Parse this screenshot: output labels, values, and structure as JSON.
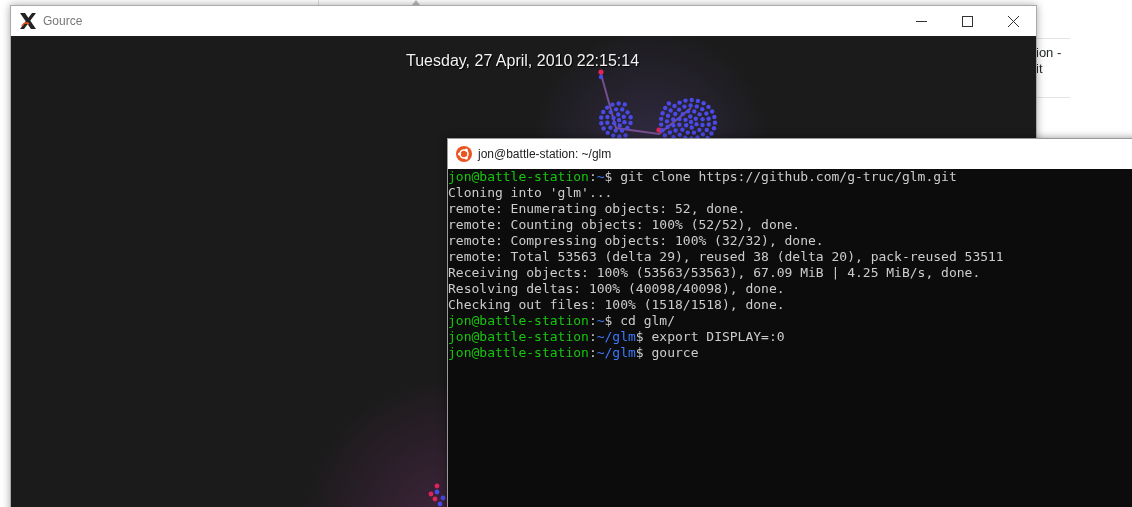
{
  "background_page": {
    "side_fragments": [
      "ion -",
      "it"
    ]
  },
  "gource_window": {
    "title": "Gource",
    "date_time": "Tuesday, 27 April, 2010 22:15:14"
  },
  "terminal": {
    "title": "jon@battle-station: ~/glm",
    "lines": [
      {
        "kind": "prompt",
        "user": "jon@battle-station",
        "sep": ":",
        "path": "~",
        "command": "$ git clone https://github.com/g-truc/glm.git"
      },
      {
        "kind": "output",
        "text": "Cloning into 'glm'..."
      },
      {
        "kind": "output",
        "text": "remote: Enumerating objects: 52, done."
      },
      {
        "kind": "output",
        "text": "remote: Counting objects: 100% (52/52), done."
      },
      {
        "kind": "output",
        "text": "remote: Compressing objects: 100% (32/32), done."
      },
      {
        "kind": "output",
        "text": "remote: Total 53563 (delta 29), reused 38 (delta 20), pack-reused 53511"
      },
      {
        "kind": "output",
        "text": "Receiving objects: 100% (53563/53563), 67.09 MiB | 4.25 MiB/s, done."
      },
      {
        "kind": "output",
        "text": "Resolving deltas: 100% (40098/40098), done."
      },
      {
        "kind": "output",
        "text": "Checking out files: 100% (1518/1518), done."
      },
      {
        "kind": "prompt",
        "user": "jon@battle-station",
        "sep": ":",
        "path": "~",
        "command": "$ cd glm/"
      },
      {
        "kind": "prompt",
        "user": "jon@battle-station",
        "sep": ":",
        "path": "~/glm",
        "command": "$ export DISPLAY=:0"
      },
      {
        "kind": "prompt",
        "user": "jon@battle-station",
        "sep": ":",
        "path": "~/glm",
        "command": "$ gource"
      }
    ]
  }
}
